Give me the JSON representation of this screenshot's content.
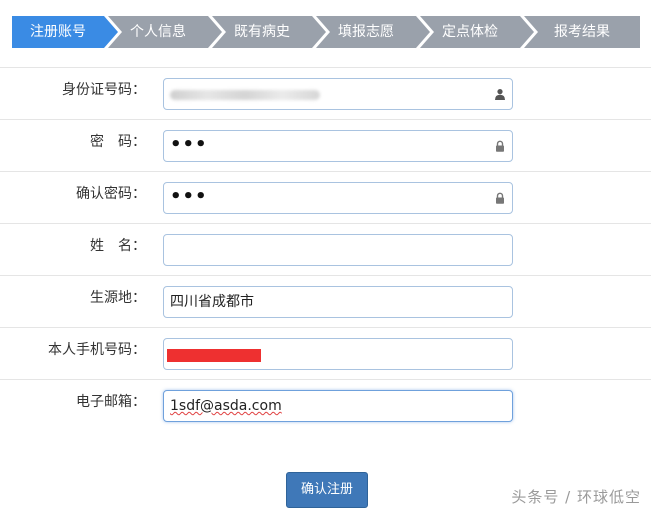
{
  "steps": [
    {
      "label": "注册账号",
      "active": true
    },
    {
      "label": "个人信息",
      "active": false
    },
    {
      "label": "既有病史",
      "active": false
    },
    {
      "label": "填报志愿",
      "active": false
    },
    {
      "label": "定点体检",
      "active": false
    },
    {
      "label": "报考结果",
      "active": false
    }
  ],
  "form": {
    "id_number": {
      "label": "身份证号码：",
      "icon": "user-icon"
    },
    "password": {
      "label": "密　码：",
      "value": "•••",
      "icon": "lock-icon"
    },
    "confirm_password": {
      "label": "确认密码：",
      "value": "•••",
      "icon": "lock-icon"
    },
    "name": {
      "label": "姓　名：",
      "value": ""
    },
    "origin": {
      "label": "生源地：",
      "value": "四川省成都市"
    },
    "phone": {
      "label": "本人手机号码："
    },
    "email": {
      "label": "电子邮箱：",
      "value": "1sdf@asda.com"
    }
  },
  "submit_label": "确认注册",
  "watermark": "头条号 / 环球低空",
  "colors": {
    "active_step": "#3a8be4",
    "inactive_step": "#9aa1ab",
    "button": "#3f78b8",
    "redaction": "#ee3030"
  }
}
